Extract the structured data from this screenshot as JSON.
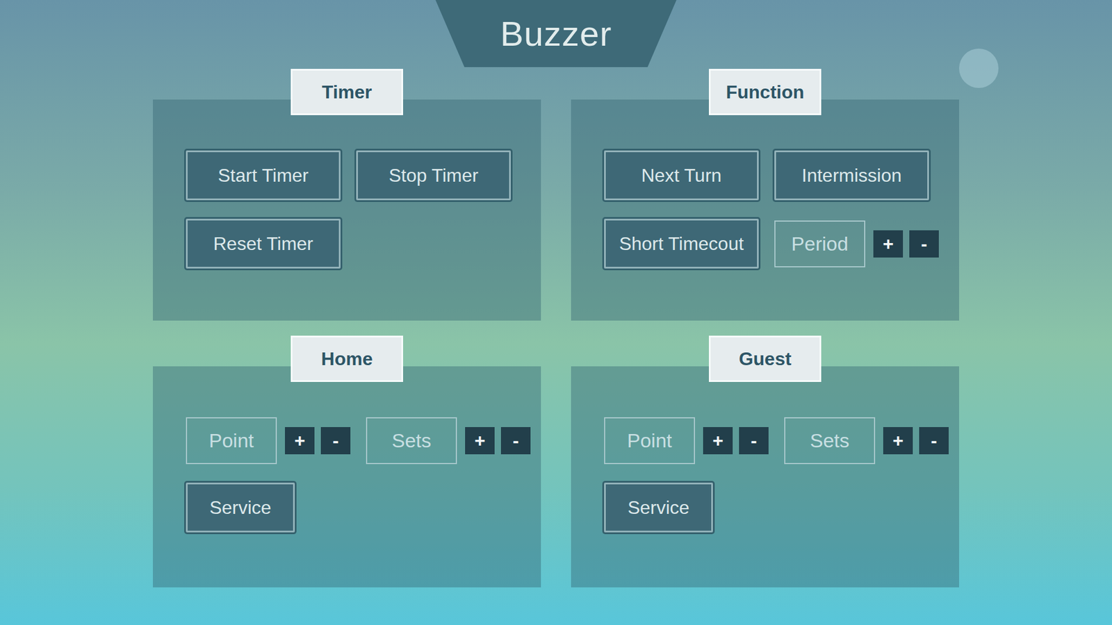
{
  "title": "Buzzer",
  "panels": [
    {
      "title": "Timer",
      "rows": [
        [
          {
            "kind": "button",
            "label": "Start Timer"
          },
          {
            "kind": "button",
            "label": "Stop Timer"
          }
        ],
        [
          {
            "kind": "button",
            "label": "Reset Timer"
          }
        ]
      ]
    },
    {
      "title": "Function",
      "rows": [
        [
          {
            "kind": "button",
            "label": "Next Turn"
          },
          {
            "kind": "button",
            "label": "Intermission"
          }
        ],
        [
          {
            "kind": "button",
            "label": "Short Timecout"
          },
          {
            "kind": "counter",
            "label": "Period",
            "plus": "+",
            "minus": "-"
          }
        ]
      ]
    },
    {
      "title": "Home",
      "rows": [
        [
          {
            "kind": "counter",
            "label": "Point",
            "plus": "+",
            "minus": "-"
          },
          {
            "kind": "counter",
            "label": "Sets",
            "plus": "+",
            "minus": "-"
          }
        ],
        [
          {
            "kind": "button",
            "label": "Service"
          }
        ]
      ]
    },
    {
      "title": "Guest",
      "rows": [
        [
          {
            "kind": "counter",
            "label": "Point",
            "plus": "+",
            "minus": "-"
          },
          {
            "kind": "counter",
            "label": "Sets",
            "plus": "+",
            "minus": "-"
          }
        ],
        [
          {
            "kind": "button",
            "label": "Service"
          }
        ]
      ]
    }
  ]
}
